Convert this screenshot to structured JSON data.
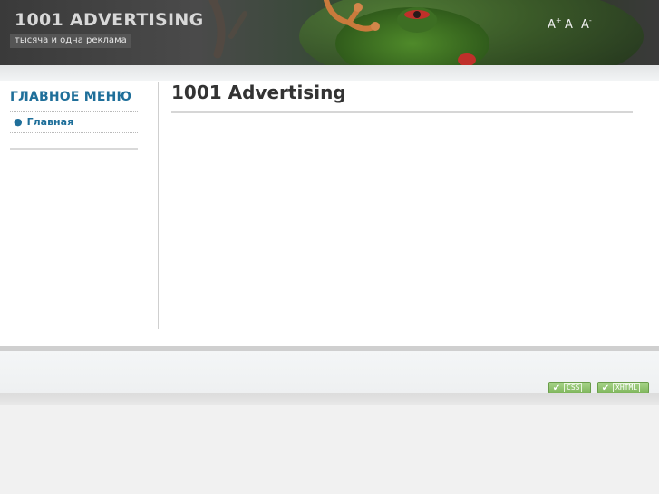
{
  "header": {
    "site_title": "1001 ADVERTISING",
    "slogan": "тысяча и одна реклама",
    "font_controls": {
      "increase": {
        "glyph": "A",
        "mark": "+"
      },
      "reset": {
        "glyph": "A"
      },
      "decrease": {
        "glyph": "A",
        "mark": "-"
      }
    }
  },
  "sidebar": {
    "menu_title": "ГЛАВНОЕ МЕНЮ",
    "items": [
      {
        "bullet": "●",
        "label": "Главная"
      }
    ]
  },
  "main": {
    "title": "1001 Advertising"
  },
  "footer": {
    "badges": [
      {
        "label": "CSS",
        "icon": "check-icon"
      },
      {
        "label": "XHTML",
        "icon": "check-icon"
      }
    ]
  },
  "colors": {
    "accent": "#1f6f9a",
    "badge_green": "#7db45a"
  }
}
